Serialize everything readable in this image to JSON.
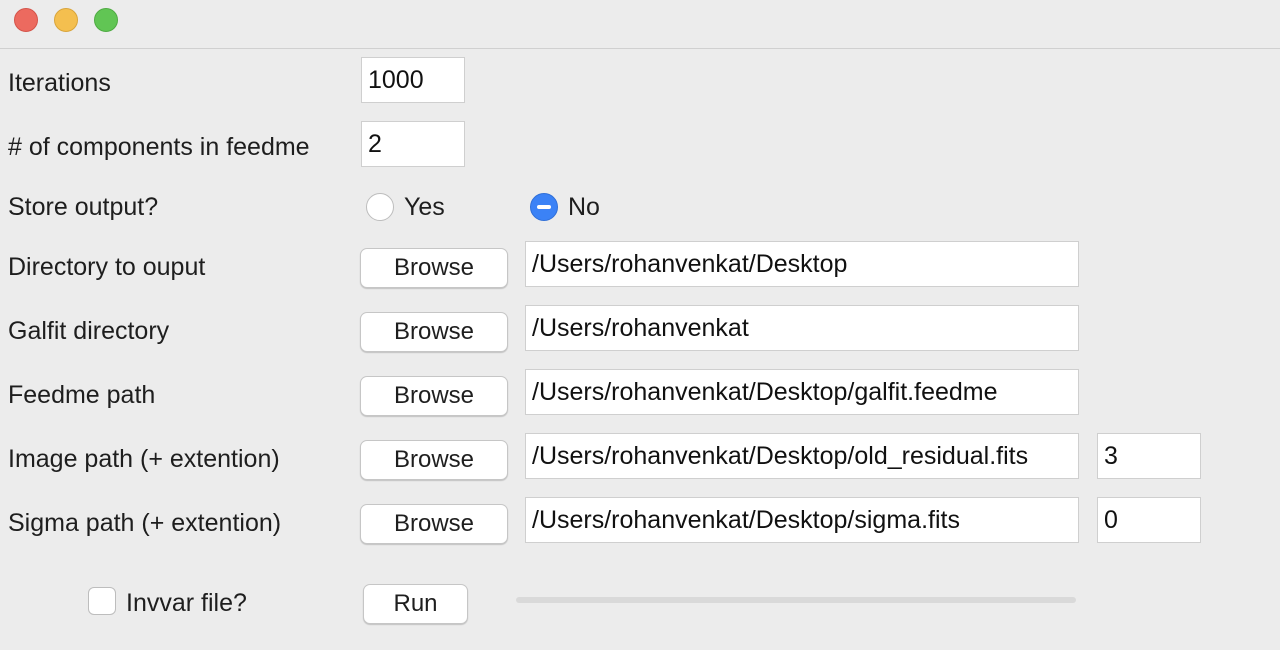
{
  "window": {
    "controls": [
      "close",
      "minimize",
      "maximize"
    ]
  },
  "form": {
    "iterations": {
      "label": "Iterations",
      "value": "1000"
    },
    "components": {
      "label": "# of components in feedme",
      "value": "2"
    },
    "store_output": {
      "label": "Store output?",
      "options": [
        "Yes",
        "No"
      ],
      "selected": "No"
    },
    "output_dir": {
      "label": "Directory to ouput",
      "button": "Browse",
      "value": "/Users/rohanvenkat/Desktop"
    },
    "galfit_dir": {
      "label": "Galfit directory",
      "button": "Browse",
      "value": "/Users/rohanvenkat"
    },
    "feedme_path": {
      "label": "Feedme path",
      "button": "Browse",
      "value": "/Users/rohanvenkat/Desktop/galfit.feedme"
    },
    "image_path": {
      "label": "Image path (+ extention)",
      "button": "Browse",
      "value": "/Users/rohanvenkat/Desktop/old_residual.fits",
      "extension": "3"
    },
    "sigma_path": {
      "label": "Sigma path (+ extention)",
      "button": "Browse",
      "value": "/Users/rohanvenkat/Desktop/sigma.fits",
      "extension": "0"
    },
    "invvar": {
      "label": "Invvar file?",
      "checked": false
    },
    "run_label": "Run",
    "progress": 0
  },
  "colors": {
    "accent": "#3b82f6",
    "background": "#ececec"
  }
}
